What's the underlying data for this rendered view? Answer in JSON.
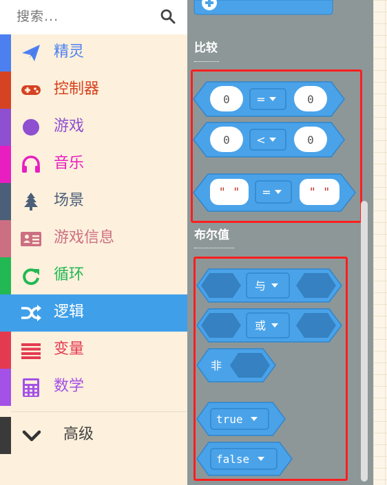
{
  "search": {
    "placeholder": "搜索..."
  },
  "categories": [
    {
      "label": "精灵",
      "color": "#4c80f0",
      "icon": "paper-plane-icon"
    },
    {
      "label": "控制器",
      "color": "#d54322",
      "icon": "gamepad-icon"
    },
    {
      "label": "游戏",
      "color": "#8e4fd0",
      "icon": "circle-icon"
    },
    {
      "label": "音乐",
      "color": "#e91ec1",
      "icon": "headphones-icon"
    },
    {
      "label": "场景",
      "color": "#4b5f79",
      "icon": "tree-icon"
    },
    {
      "label": "游戏信息",
      "color": "#cc6f82",
      "icon": "id-card-icon"
    },
    {
      "label": "循环",
      "color": "#22b853",
      "icon": "refresh-icon"
    },
    {
      "label": "逻辑",
      "color": "#3f9fe9",
      "icon": "shuffle-icon",
      "selected": true
    },
    {
      "label": "变量",
      "color": "#e43a51",
      "icon": "list-icon"
    },
    {
      "label": "数学",
      "color": "#a451e7",
      "icon": "calculator-icon"
    }
  ],
  "advanced": {
    "label": "高级",
    "icon": "chevron-down-icon"
  },
  "flyout": {
    "comparison_heading": "比较",
    "boolean_heading": "布尔值",
    "blocks": {
      "eq_left": "0",
      "eq_op": "=",
      "eq_right": "0",
      "lt_left": "0",
      "lt_op": "<",
      "lt_right": "0",
      "str_left": "\" \"",
      "str_op": "=",
      "str_right": "\" \"",
      "and_op": "与",
      "or_op": "或",
      "not_label": "非",
      "true_label": "true",
      "false_label": "false"
    }
  },
  "colors": {
    "logic_block": "#4aa3e9",
    "highlight": "#ff1e1e"
  }
}
